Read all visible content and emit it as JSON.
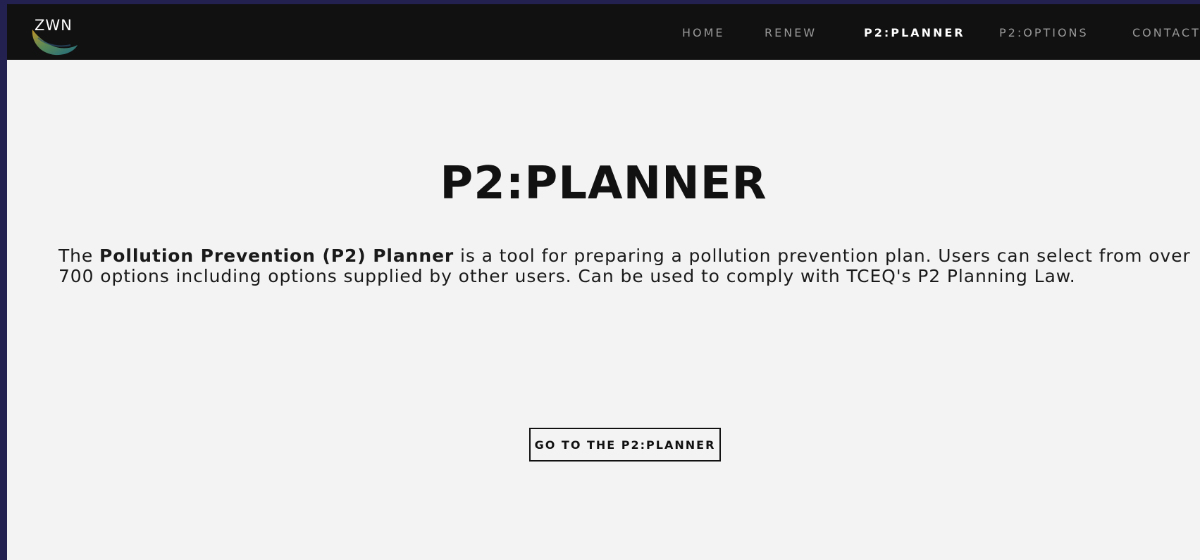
{
  "header": {
    "logo_text": "ZWN",
    "nav": [
      {
        "label": "HOME",
        "active": false
      },
      {
        "label": "RENEW",
        "active": false
      },
      {
        "label": "P2:PLANNER",
        "active": true
      },
      {
        "label": "P2:OPTIONS",
        "active": false
      },
      {
        "label": "CONTACT",
        "active": false
      }
    ]
  },
  "main": {
    "title": "P2:PLANNER",
    "intro": {
      "prefix": "The ",
      "bold": "Pollution Prevention (P2) Planner",
      "suffix": " is a tool for preparing a pollution prevention plan. Users can select from over 700 options including options supplied by other users. Can be used to comply with TCEQ's P2 Planning Law."
    },
    "cta_label": "GO TO THE P2:PLANNER"
  },
  "colors": {
    "outer_background": "#23214f",
    "navbar": "#111111",
    "page_background": "#f3f3f3",
    "nav_inactive": "#9a9a9a",
    "nav_active": "#ffffff",
    "text": "#111111"
  },
  "icons": {
    "logo": "zwn-leaf-logo-icon"
  }
}
